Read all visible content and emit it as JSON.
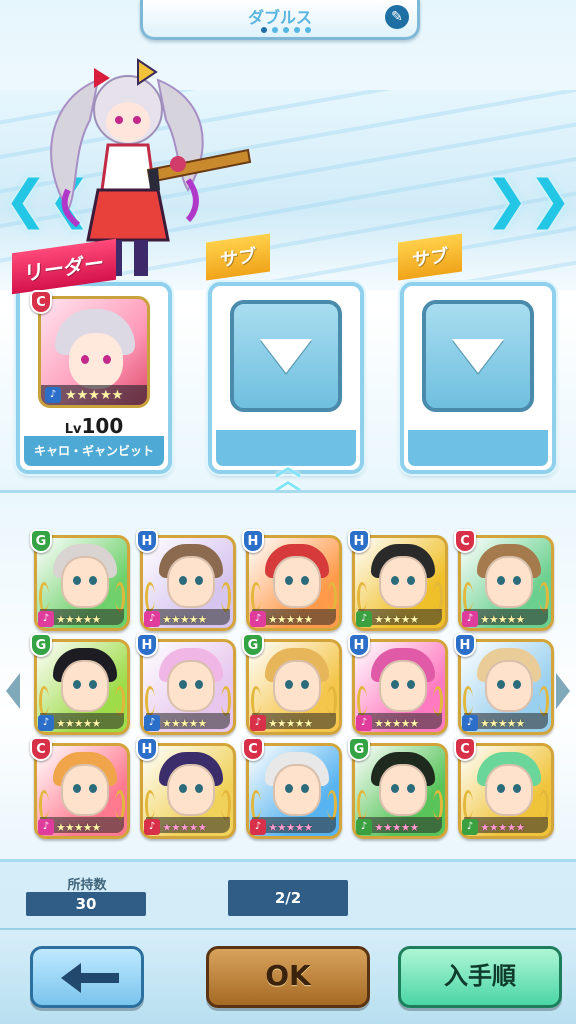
{
  "header": {
    "title": "ダブルス",
    "page_dots": 5,
    "active_dot": 0,
    "edit_icon": "pencil-icon"
  },
  "stage": {
    "left_arrow": "❮❮",
    "right_arrow": "❯❯"
  },
  "party": {
    "leader": {
      "tag": "リーダー",
      "rarity": "C",
      "level_prefix": "Lv",
      "level": "100",
      "name": "キャロ・ギャンビット",
      "stars": "★★★★★"
    },
    "sub1": {
      "tag": "サブ"
    },
    "sub2": {
      "tag": "サブ"
    },
    "expand_icon": "chevron-up-icon"
  },
  "roster": {
    "cards": [
      {
        "rarity": "G",
        "type": "♪",
        "type_color": "#e03c9c",
        "stars": "★★★★★",
        "star_style": "gold",
        "bg": "#6fd16b",
        "hair": "#d9d4d2"
      },
      {
        "rarity": "H",
        "type": "♪",
        "type_color": "#e03c9c",
        "stars": "★★★★★",
        "star_style": "gold",
        "bg": "#d6c5ef",
        "hair": "#8b6a50"
      },
      {
        "rarity": "H",
        "type": "♪",
        "type_color": "#e03c9c",
        "stars": "★★★★★",
        "star_style": "gold",
        "bg": "#ff9a4a",
        "hair": "#d63a3a"
      },
      {
        "rarity": "H",
        "type": "♪",
        "type_color": "#3aa040",
        "stars": "★★★★★",
        "star_style": "gold",
        "bg": "#f0c02a",
        "hair": "#2a2a2a"
      },
      {
        "rarity": "C",
        "type": "♪",
        "type_color": "#e03c9c",
        "stars": "★★★★★",
        "star_style": "gold",
        "bg": "#6bd08f",
        "hair": "#a57a4c"
      },
      {
        "rarity": "G",
        "type": "♪",
        "type_color": "#2c6fc9",
        "stars": "★★★★★",
        "star_style": "gold",
        "bg": "#9fdc4a",
        "hair": "#1c1c22"
      },
      {
        "rarity": "H",
        "type": "♪",
        "type_color": "#2c6fc9",
        "stars": "★★★★★",
        "star_style": "gold",
        "bg": "#e7c7ee",
        "hair": "#f0b6e6"
      },
      {
        "rarity": "G",
        "type": "♪",
        "type_color": "#d83048",
        "stars": "★★★★★",
        "star_style": "gold",
        "bg": "#f4c64c",
        "hair": "#e8b65a"
      },
      {
        "rarity": "H",
        "type": "♪",
        "type_color": "#e03c9c",
        "stars": "★★★★★",
        "star_style": "gold",
        "bg": "#ff7ac0",
        "hair": "#e05aa8"
      },
      {
        "rarity": "H",
        "type": "♪",
        "type_color": "#2c6fc9",
        "stars": "★★★★★",
        "star_style": "gold",
        "bg": "#9ad0ef",
        "hair": "#e9cc98"
      },
      {
        "rarity": "C",
        "type": "♪",
        "type_color": "#e03c9c",
        "stars": "★★★★★",
        "star_style": "gold",
        "bg": "#ff7a8f",
        "hair": "#f0a54a"
      },
      {
        "rarity": "H",
        "type": "♪",
        "type_color": "#d83048",
        "stars": "★★★★★",
        "star_style": "pink",
        "bg": "#f0d25a",
        "hair": "#3b2c6a"
      },
      {
        "rarity": "C",
        "type": "♪",
        "type_color": "#d83048",
        "stars": "★★★★★",
        "star_style": "pink",
        "bg": "#58b4f0",
        "hair": "#e8e8e8"
      },
      {
        "rarity": "G",
        "type": "♪",
        "type_color": "#3aa040",
        "stars": "★★★★★",
        "star_style": "pink",
        "bg": "#58c45a",
        "hair": "#1d2a1d"
      },
      {
        "rarity": "C",
        "type": "♪",
        "type_color": "#3aa040",
        "stars": "★★★★★",
        "star_style": "pink",
        "bg": "#f0c43a",
        "hair": "#6ad69a"
      }
    ]
  },
  "counters": {
    "owned_label": "所持数",
    "owned_count": "30",
    "page_count": "2/2"
  },
  "buttons": {
    "back_icon": "back-arrow-icon",
    "ok": "OK",
    "sort": "入手順"
  }
}
